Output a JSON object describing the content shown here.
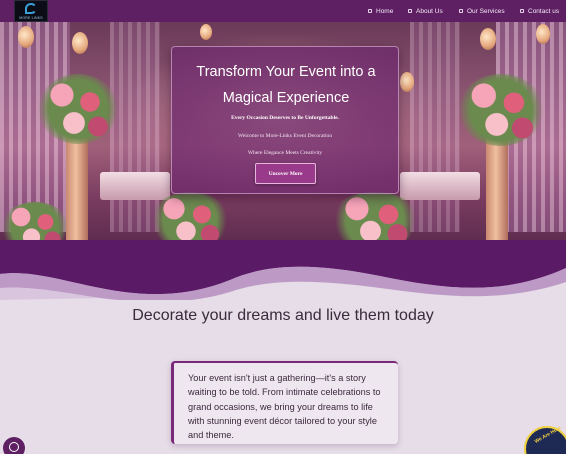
{
  "nav": {
    "logo_text": "MORE LINKS",
    "items": [
      {
        "label": "Home",
        "icon": "home-icon"
      },
      {
        "label": "About Us",
        "icon": "info-icon"
      },
      {
        "label": "Our Services",
        "icon": "services-icon"
      },
      {
        "label": "Contact us",
        "icon": "contact-icon"
      }
    ]
  },
  "hero": {
    "title": "Transform Your Event into a Magical Experience",
    "tagline": "Every Occasion Deserves to Be Unforgettable.",
    "welcome": "Welcome to More-Links Event Decoration",
    "motto": "Where Elegance Meets Creativity",
    "cta_label": "Uncover More"
  },
  "section": {
    "heading": "Decorate your dreams and live them today",
    "story": "Your event isn't just a gathering—it's a story waiting to be told. From intimate celebrations to grand occasions, we bring your dreams to life with stunning event décor tailored to your style and theme."
  },
  "floating": {
    "chat_icon": "whatsapp-icon",
    "badge_text": "We Are Here"
  },
  "colors": {
    "brand": "#5e1f63",
    "accent": "#9a3a8a",
    "page_bg": "#e6dde8"
  }
}
